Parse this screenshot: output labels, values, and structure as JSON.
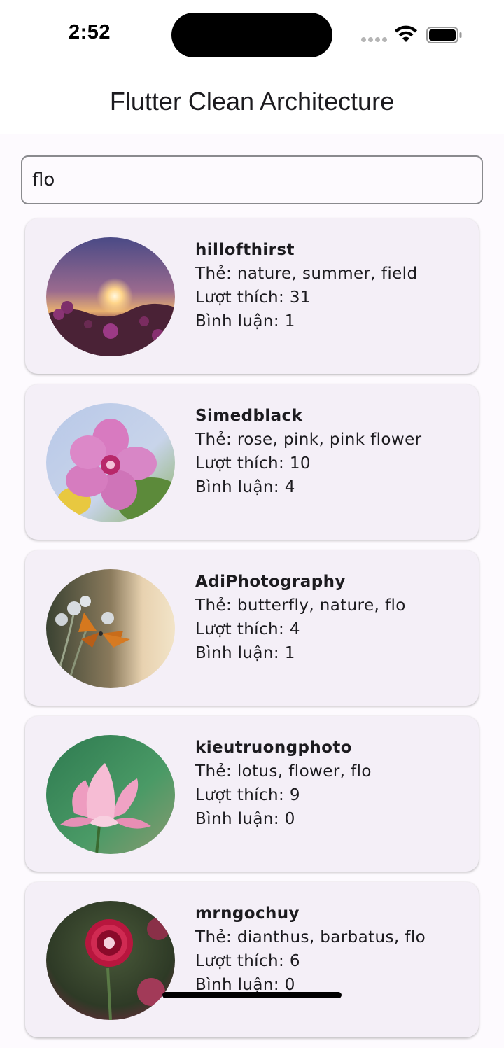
{
  "status_bar": {
    "time": "2:52"
  },
  "app_bar": {
    "title": "Flutter Clean Architecture"
  },
  "search": {
    "value": "flo"
  },
  "labels": {
    "tags_prefix": "Thẻ: ",
    "likes_prefix": "Lượt thích: ",
    "comments_prefix": "Bình luận: "
  },
  "results": [
    {
      "username": "hillofthirst",
      "tags": "Thẻ: nature, summer, field",
      "likes": "Lượt thích: 31",
      "comments": "Bình luận: 1",
      "image_icon": "sunset-flower-field-photo"
    },
    {
      "username": "Simedblack",
      "tags": "Thẻ: rose, pink, pink flower",
      "likes": "Lượt thích: 10",
      "comments": "Bình luận: 4",
      "image_icon": "pink-flower-photo"
    },
    {
      "username": "AdiPhotography",
      "tags": "Thẻ: butterfly, nature, flo",
      "likes": "Lượt thích: 4",
      "comments": "Bình luận: 1",
      "image_icon": "butterfly-photo"
    },
    {
      "username": "kieutruongphoto",
      "tags": "Thẻ: lotus, flower, flo",
      "likes": "Lượt thích: 9",
      "comments": "Bình luận: 0",
      "image_icon": "lotus-photo"
    },
    {
      "username": "mrngochuy",
      "tags": "Thẻ: dianthus, barbatus, flo",
      "likes": "Lượt thích: 6",
      "comments": "Bình luận: 0",
      "image_icon": "dianthus-photo"
    }
  ],
  "colors": {
    "card_background": "#f4eff7",
    "page_background": "#fdfafe",
    "text": "#1c1b1f",
    "search_border": "#8a8a8e"
  }
}
